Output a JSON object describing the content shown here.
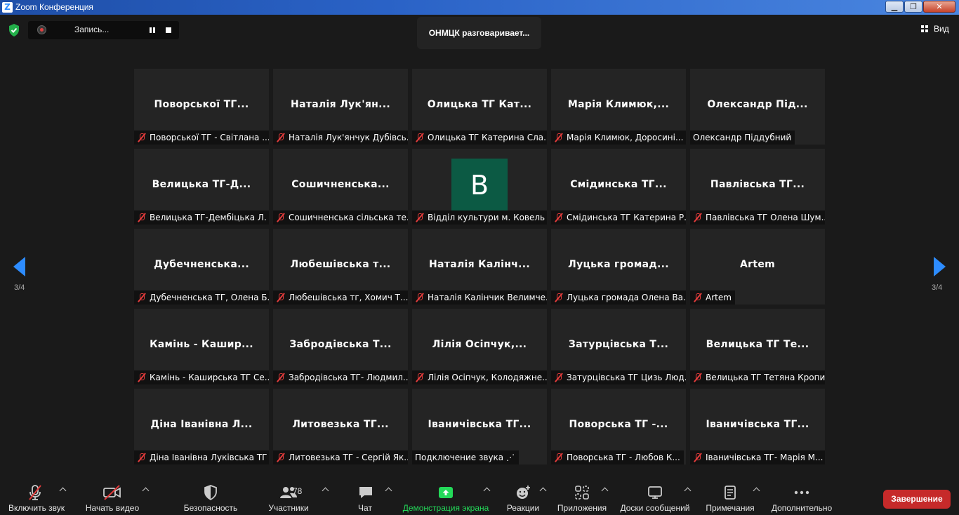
{
  "window": {
    "title": "Zoom Конференция",
    "logo_letter": "Z"
  },
  "window_controls": {
    "minimize": "▁",
    "maximize": "❐",
    "close": "✕"
  },
  "recording": {
    "label": "Запись..."
  },
  "active_speaker": {
    "text": "ОНМЦК разговаривает..."
  },
  "view": {
    "label": "Вид"
  },
  "pagination": {
    "left": "3/4",
    "right": "3/4"
  },
  "tiles": [
    {
      "name": "Поворської ТГ...",
      "caption": "Поворської ТГ - Світлана ...",
      "muted": true
    },
    {
      "name": "Наталія Лук'ян...",
      "caption": "Наталія Лук'янчук Дубівсь...",
      "muted": true
    },
    {
      "name": "Олицька ТГ Кат...",
      "caption": "Олицька ТГ Катерина Сла...",
      "muted": true
    },
    {
      "name": "Марія Климюк,...",
      "caption": "Марія Климюк, Доросині...",
      "muted": true
    },
    {
      "name": "Олександр Під...",
      "caption": "Олександр Піддубний",
      "muted": false
    },
    {
      "name": "Велицька ТГ-Д...",
      "caption": "Велицька ТГ-Дембіцька Л.",
      "muted": true
    },
    {
      "name": "Сошичненська...",
      "caption": "Сошичненська сільська те...",
      "muted": true
    },
    {
      "name": "",
      "avatar": "B",
      "caption": "Відділ культури м. Ковель",
      "muted": true
    },
    {
      "name": "Смідинська ТГ...",
      "caption": "Смідинська ТГ Катерина Р...",
      "muted": true
    },
    {
      "name": "Павлівська ТГ...",
      "caption": "Павлівська ТГ Олена Шум...",
      "muted": true
    },
    {
      "name": "Дубечненська...",
      "caption": "Дубечненська ТГ, Олена Б...",
      "muted": true
    },
    {
      "name": "Любешівська т...",
      "caption": "Любешівська тг, Хомич Т...",
      "muted": true
    },
    {
      "name": "Наталія Калінч...",
      "caption": "Наталія Калінчик Велимче...",
      "muted": true
    },
    {
      "name": "Луцька громад...",
      "caption": "Луцька громада Олена Ва...",
      "muted": true
    },
    {
      "name": "Artem",
      "caption": "Artem",
      "muted": true
    },
    {
      "name": "Камінь - Кашир...",
      "caption": "Камінь - Каширська ТГ Се...",
      "muted": true
    },
    {
      "name": "Забродівська Т...",
      "caption": "Забродівська ТГ- Людмил...",
      "muted": true
    },
    {
      "name": "Лілія Осіпчук,...",
      "caption": "Лілія Осіпчук, Колодяжне...",
      "muted": true
    },
    {
      "name": "Затурцівська Т...",
      "caption": "Затурцівська ТГ Цизь Люд...",
      "muted": true
    },
    {
      "name": "Велицька ТГ Те...",
      "caption": "Велицька ТГ Тетяна Кропи...",
      "muted": true
    },
    {
      "name": "Діна Іванівна Л...",
      "caption": "Діна Іванівна Луківська ТГ",
      "muted": true
    },
    {
      "name": "Литовезька ТГ...",
      "caption": "Литовезька ТГ - Сергій Як...",
      "muted": true
    },
    {
      "name": "Іваничівська ТГ...",
      "caption": "Подключение звука",
      "muted": false,
      "connecting": true
    },
    {
      "name": "Поворська ТГ -...",
      "caption": "Поворська ТГ - Любов К...",
      "muted": true
    },
    {
      "name": "Іваничівська ТГ...",
      "caption": "Іваничівська ТГ- Марія М...",
      "muted": true
    }
  ],
  "toolbar": {
    "unmute": "Включить звук",
    "start_video": "Начать видео",
    "security": "Безопасность",
    "participants": "Участники",
    "participants_count": "78",
    "chat": "Чат",
    "share_screen": "Демонстрация экрана",
    "reactions": "Реакции",
    "apps": "Приложения",
    "whiteboards": "Доски сообщений",
    "notes": "Примечания",
    "more": "Дополнительно",
    "end": "Завершение"
  },
  "colors": {
    "accent": "#2d8cff",
    "share_green": "#23d959",
    "end_red": "#c62a2a",
    "avatar_bg": "#0c5a44",
    "muted_red": "#e23b3b"
  }
}
